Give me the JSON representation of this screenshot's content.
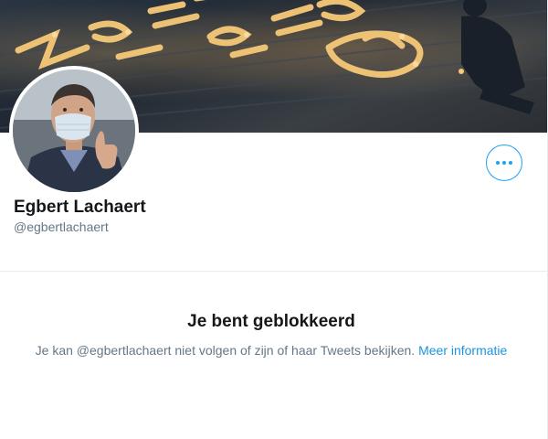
{
  "profile": {
    "display_name": "Egbert Lachaert",
    "handle": "@egbertlachaert"
  },
  "blocked": {
    "title": "Je bent geblokkeerd",
    "message": "Je kan @egbertlachaert niet volgen of zijn of haar Tweets bekijken.",
    "link_label": "Meer informatie"
  },
  "icons": {
    "more": "more-horizontal-icon"
  },
  "colors": {
    "accent": "#1da1f2",
    "link": "#1b95e0",
    "text_primary": "#14171a",
    "text_secondary": "#657786",
    "divider": "#e6ecf0"
  }
}
